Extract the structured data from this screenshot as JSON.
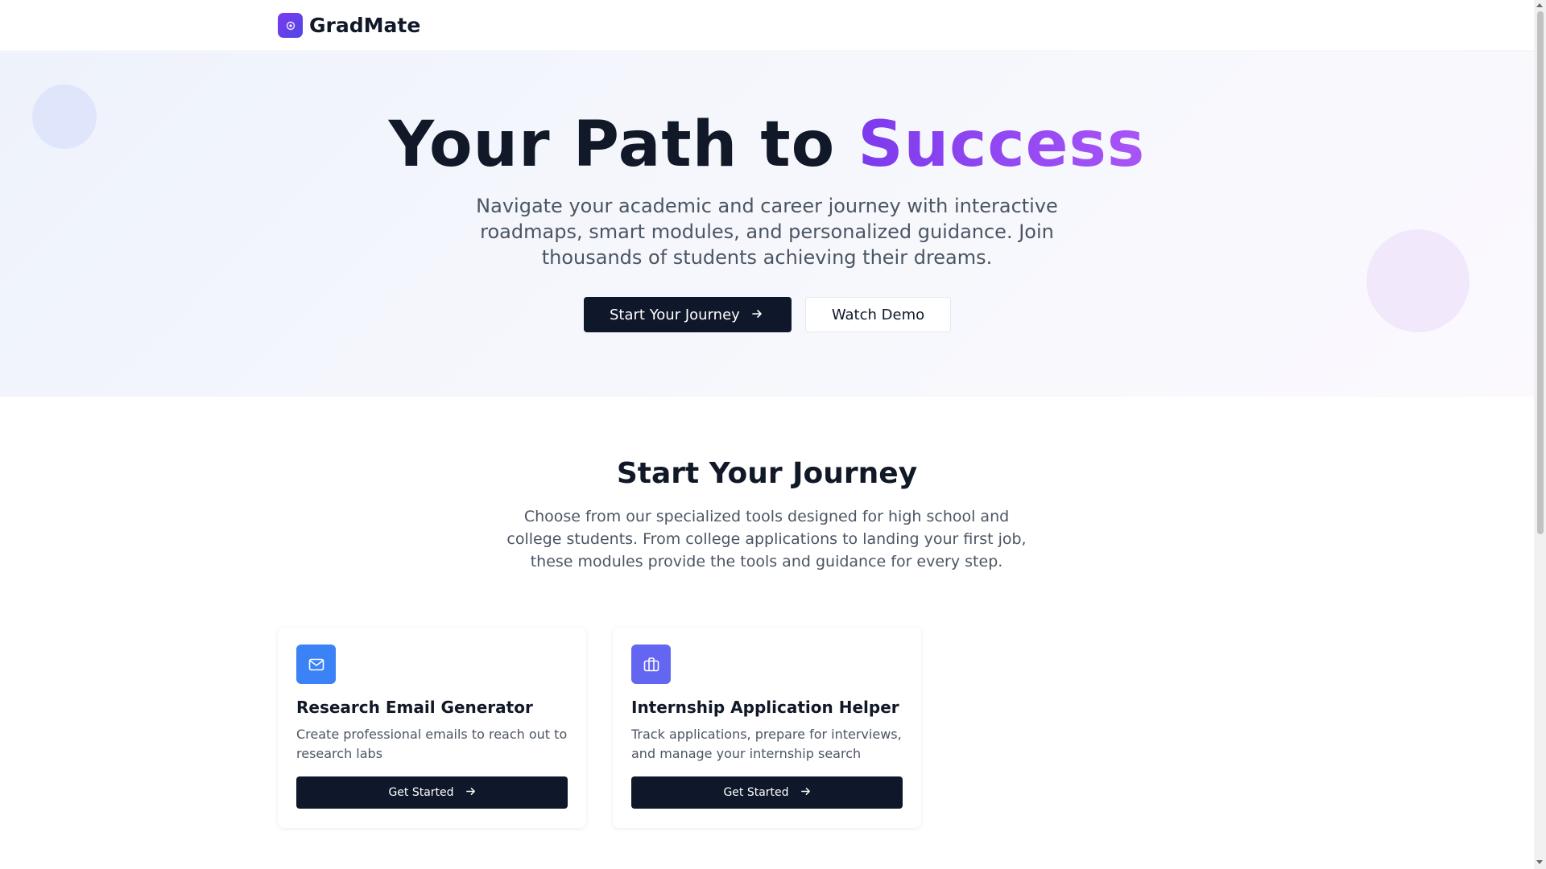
{
  "header": {
    "brand": "GradMate",
    "logo_icon": "sparkle-icon"
  },
  "hero": {
    "title_main": "Your Path to ",
    "title_accent": "Success",
    "subtitle": "Navigate your academic and career journey with interactive roadmaps, smart modules, and personalized guidance. Join thousands of students achieving their dreams.",
    "primary_button": "Start Your Journey",
    "secondary_button": "Watch Demo"
  },
  "journey": {
    "title": "Start Your Journey",
    "subtitle": "Choose from our specialized tools designed for high school and college students. From college applications to landing your first job, these modules provide the tools and guidance for every step."
  },
  "modules": [
    {
      "icon": "mail-icon",
      "title": "Research Email Generator",
      "description": "Create professional emails to reach out to research labs",
      "button": "Get Started"
    },
    {
      "icon": "briefcase-icon",
      "title": "Internship Application Helper",
      "description": "Track applications, prepare for interviews, and manage your internship search",
      "button": "Get Started"
    }
  ],
  "colors": {
    "primary_dark": "#0f172a",
    "accent_purple": "#7c3aed",
    "icon_blue": "#3b82f6",
    "icon_indigo": "#6366f1"
  }
}
